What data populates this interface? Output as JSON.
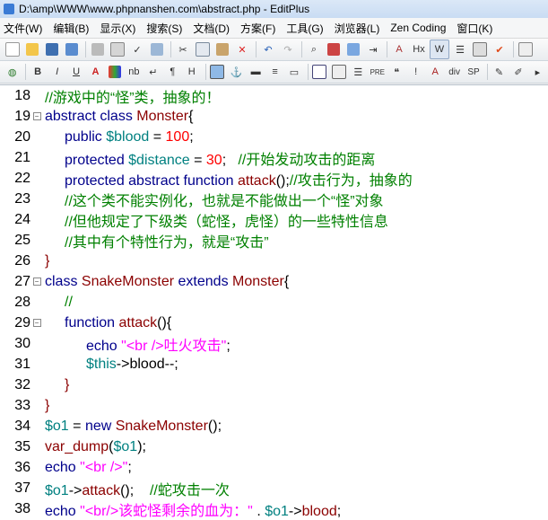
{
  "window": {
    "title": "D:\\amp\\WWW\\www.phpnanshen.com\\abstract.php - EditPlus"
  },
  "menu": [
    "文件(W)",
    "编辑(B)",
    "显示(X)",
    "搜索(S)",
    "文档(D)",
    "方案(F)",
    "工具(G)",
    "浏览器(L)",
    "Zen Coding",
    "窗口(K)"
  ],
  "code_lines": [
    {
      "num": "18",
      "indent": 0,
      "fold": "",
      "parts": [
        {
          "t": "//游戏中的“怪”类，抽象的！",
          "c": "c"
        }
      ]
    },
    {
      "num": "19",
      "indent": 0,
      "fold": "⊟",
      "parts": [
        {
          "t": "abstract class ",
          "c": "k"
        },
        {
          "t": "Monster",
          "c": "cls"
        },
        {
          "t": "{",
          "c": "p"
        }
      ]
    },
    {
      "num": "20",
      "indent": 1,
      "fold": "",
      "parts": [
        {
          "t": "public ",
          "c": "k"
        },
        {
          "t": "$blood",
          "c": "v"
        },
        {
          "t": " = ",
          "c": "p"
        },
        {
          "t": "100",
          "c": "n"
        },
        {
          "t": ";",
          "c": "p"
        }
      ]
    },
    {
      "num": "21",
      "indent": 1,
      "fold": "",
      "parts": [
        {
          "t": "protected ",
          "c": "k"
        },
        {
          "t": "$distance",
          "c": "v"
        },
        {
          "t": " = ",
          "c": "p"
        },
        {
          "t": "30",
          "c": "n"
        },
        {
          "t": ";   ",
          "c": "p"
        },
        {
          "t": "//开始发动攻击的距离",
          "c": "c"
        }
      ]
    },
    {
      "num": "22",
      "indent": 1,
      "fold": "",
      "parts": [
        {
          "t": "protected abstract function ",
          "c": "k"
        },
        {
          "t": "attack",
          "c": "f"
        },
        {
          "t": "();",
          "c": "p"
        },
        {
          "t": "//攻击行为，抽象的",
          "c": "c"
        }
      ]
    },
    {
      "num": "23",
      "indent": 1,
      "fold": "",
      "parts": [
        {
          "t": "//这个类不能实例化，也就是不能做出一个“怪”对象",
          "c": "c"
        }
      ]
    },
    {
      "num": "24",
      "indent": 1,
      "fold": "",
      "parts": [
        {
          "t": "//但他规定了下级类（蛇怪，虎怪）的一些特性信息",
          "c": "c"
        }
      ]
    },
    {
      "num": "25",
      "indent": 1,
      "fold": "",
      "parts": [
        {
          "t": "//其中有个特性行为，就是“攻击”",
          "c": "c"
        }
      ]
    },
    {
      "num": "26",
      "indent": 0,
      "fold": "",
      "parts": [
        {
          "t": "}",
          "c": "cls"
        }
      ]
    },
    {
      "num": "27",
      "indent": 0,
      "fold": "⊟",
      "parts": [
        {
          "t": "class ",
          "c": "k"
        },
        {
          "t": "SnakeMonster",
          "c": "cls"
        },
        {
          "t": " extends ",
          "c": "k"
        },
        {
          "t": "Monster",
          "c": "cls"
        },
        {
          "t": "{",
          "c": "p"
        }
      ]
    },
    {
      "num": "28",
      "indent": 1,
      "fold": "",
      "parts": [
        {
          "t": "//",
          "c": "c"
        }
      ]
    },
    {
      "num": "29",
      "indent": 1,
      "fold": "⊟",
      "parts": [
        {
          "t": "function ",
          "c": "k"
        },
        {
          "t": "attack",
          "c": "f"
        },
        {
          "t": "(){",
          "c": "p"
        }
      ]
    },
    {
      "num": "30",
      "indent": 2,
      "fold": "",
      "parts": [
        {
          "t": "echo ",
          "c": "k"
        },
        {
          "t": "\"<br />吐火攻击\"",
          "c": "s"
        },
        {
          "t": ";",
          "c": "p"
        }
      ]
    },
    {
      "num": "31",
      "indent": 2,
      "fold": "",
      "parts": [
        {
          "t": "$this",
          "c": "v"
        },
        {
          "t": "->blood--;",
          "c": "p"
        }
      ]
    },
    {
      "num": "32",
      "indent": 1,
      "fold": "",
      "parts": [
        {
          "t": "}",
          "c": "cls"
        }
      ]
    },
    {
      "num": "33",
      "indent": 0,
      "fold": "",
      "parts": [
        {
          "t": "}",
          "c": "cls"
        }
      ]
    },
    {
      "num": "34",
      "indent": 0,
      "fold": "",
      "parts": [
        {
          "t": "$o1",
          "c": "v"
        },
        {
          "t": " = ",
          "c": "p"
        },
        {
          "t": "new ",
          "c": "k"
        },
        {
          "t": "SnakeMonster",
          "c": "cls"
        },
        {
          "t": "();",
          "c": "p"
        }
      ]
    },
    {
      "num": "35",
      "indent": 0,
      "fold": "",
      "parts": [
        {
          "t": "var_dump",
          "c": "f"
        },
        {
          "t": "(",
          "c": "p"
        },
        {
          "t": "$o1",
          "c": "v"
        },
        {
          "t": ");",
          "c": "p"
        }
      ]
    },
    {
      "num": "36",
      "indent": 0,
      "fold": "",
      "parts": [
        {
          "t": "echo ",
          "c": "k"
        },
        {
          "t": "\"<br />\"",
          "c": "s"
        },
        {
          "t": ";",
          "c": "p"
        }
      ]
    },
    {
      "num": "37",
      "indent": 0,
      "fold": "",
      "parts": [
        {
          "t": "$o1",
          "c": "v"
        },
        {
          "t": "->",
          "c": "p"
        },
        {
          "t": "attack",
          "c": "f"
        },
        {
          "t": "();    ",
          "c": "p"
        },
        {
          "t": "//蛇攻击一次",
          "c": "c"
        }
      ]
    },
    {
      "num": "38",
      "indent": 0,
      "fold": "",
      "parts": [
        {
          "t": "echo ",
          "c": "k"
        },
        {
          "t": "\"<br/>该蛇怪剩余的血为：\"",
          "c": "s"
        },
        {
          "t": " . ",
          "c": "p"
        },
        {
          "t": "$o1",
          "c": "v"
        },
        {
          "t": "->",
          "c": "p"
        },
        {
          "t": "blood",
          "c": "f"
        },
        {
          "t": ";",
          "c": "p"
        }
      ]
    }
  ]
}
